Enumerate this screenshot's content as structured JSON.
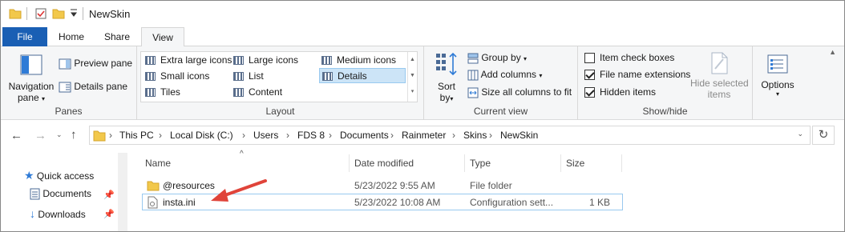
{
  "window": {
    "title": "NewSkin"
  },
  "tabs": [
    {
      "label": "File"
    },
    {
      "label": "Home"
    },
    {
      "label": "Share"
    },
    {
      "label": "View"
    }
  ],
  "ribbon": {
    "panes": {
      "navigation_pane": "Navigation",
      "navigation_pane_sub": "pane",
      "preview_pane": "Preview pane",
      "details_pane": "Details pane",
      "label": "Panes"
    },
    "layout": {
      "items": [
        "Extra large icons",
        "Large icons",
        "Medium icons",
        "Small icons",
        "List",
        "Details",
        "Tiles",
        "Content"
      ],
      "selected": "Details",
      "label": "Layout"
    },
    "current_view": {
      "sort_by": "Sort",
      "sort_by_sub": "by",
      "group_by": "Group by",
      "add_columns": "Add columns",
      "size_all_columns": "Size all columns to fit",
      "label": "Current view"
    },
    "show_hide": {
      "item_check_boxes": {
        "label": "Item check boxes",
        "checked": false
      },
      "file_name_extensions": {
        "label": "File name extensions",
        "checked": true
      },
      "hidden_items": {
        "label": "Hidden items",
        "checked": true
      },
      "hide_selected_items": "Hide selected",
      "hide_selected_items_sub": "items",
      "label": "Show/hide"
    },
    "options": {
      "label": "Options"
    }
  },
  "address": {
    "crumbs": [
      "This PC",
      "Local Disk (C:)",
      "Users",
      "FDS 8",
      "Documents",
      "Rainmeter",
      "Skins",
      "NewSkin"
    ]
  },
  "nav_pane": {
    "items": [
      {
        "label": "Quick access"
      },
      {
        "label": "Documents"
      },
      {
        "label": "Downloads"
      }
    ]
  },
  "file_list": {
    "columns": [
      "Name",
      "Date modified",
      "Type",
      "Size"
    ],
    "rows": [
      {
        "name": "@resources",
        "date": "5/23/2022 9:55 AM",
        "type": "File folder",
        "size": ""
      },
      {
        "name": "insta.ini",
        "date": "5/23/2022 10:08 AM",
        "type": "Configuration sett...",
        "size": "1 KB"
      }
    ]
  },
  "colors": {
    "accent": "#1a5fb4",
    "selection": "#cce4f7",
    "annotation_arrow": "#e0443a"
  }
}
